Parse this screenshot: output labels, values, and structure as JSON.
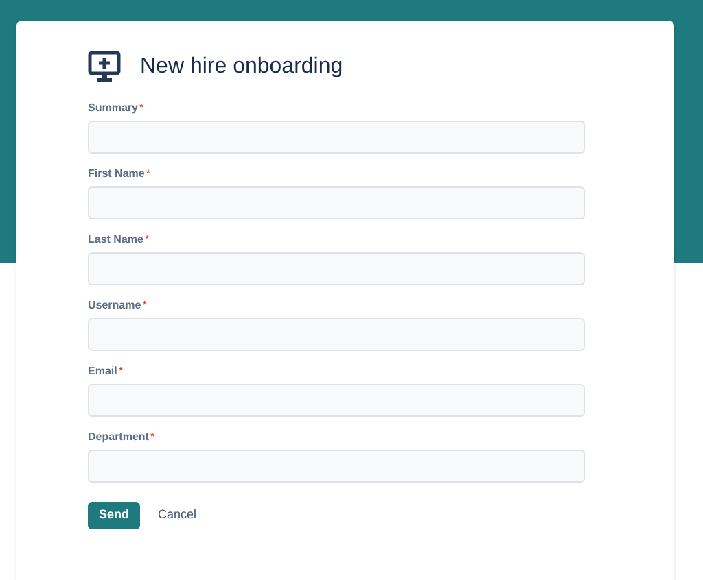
{
  "form": {
    "title": "New hire onboarding",
    "fields": [
      {
        "label": "Summary",
        "required_mark": "*"
      },
      {
        "label": "First Name",
        "required_mark": "*"
      },
      {
        "label": "Last Name",
        "required_mark": "*"
      },
      {
        "label": "Username",
        "required_mark": "*"
      },
      {
        "label": "Email",
        "required_mark": "*"
      },
      {
        "label": "Department",
        "required_mark": "*"
      }
    ],
    "buttons": [
      {
        "label": "Send",
        "kind": "primary"
      },
      {
        "label": "Cancel",
        "kind": "link"
      }
    ]
  }
}
